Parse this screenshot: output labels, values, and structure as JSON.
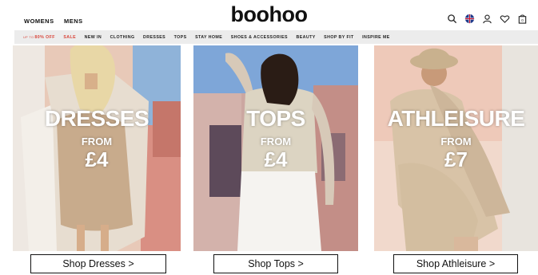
{
  "header": {
    "gender_links": [
      "WOMENS",
      "MENS"
    ],
    "logo": "boohoo",
    "icons": [
      "search-icon",
      "uk-flag-icon",
      "account-icon",
      "wishlist-heart-icon",
      "shopping-bag-icon"
    ],
    "bag_count": "0"
  },
  "nav": {
    "promo_prefix": "UP TO",
    "promo_main": "80% OFF",
    "items": [
      "SALE",
      "NEW IN",
      "CLOTHING",
      "DRESSES",
      "TOPS",
      "STAY HOME",
      "SHOES & ACCESSORIES",
      "BEAUTY",
      "SHOP BY FIT",
      "INSPIRE ME"
    ]
  },
  "panels": [
    {
      "title": "DRESSES",
      "from": "FROM",
      "price": "£4",
      "cta": "Shop Dresses >"
    },
    {
      "title": "TOPS",
      "from": "FROM",
      "price": "£4",
      "cta": "Shop Tops >"
    },
    {
      "title": "ATHLEISURE",
      "from": "FROM",
      "price": "£7",
      "cta": "Shop Athleisure >"
    }
  ],
  "colors": {
    "accent_red": "#d8453a",
    "nav_bg": "#ececec"
  }
}
